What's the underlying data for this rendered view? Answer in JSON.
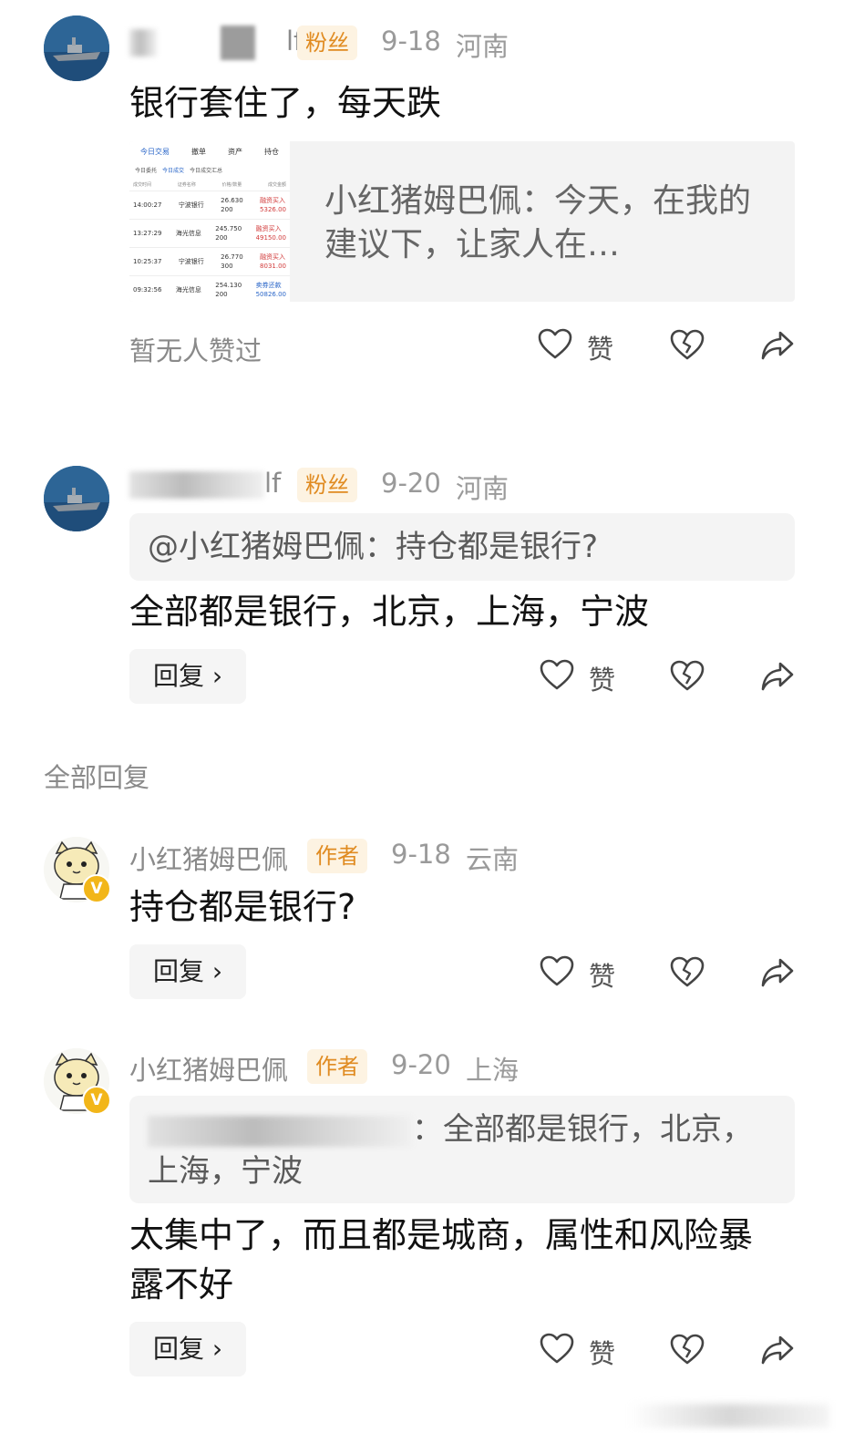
{
  "comments": [
    {
      "username_suffix": "lf",
      "badge": "粉丝",
      "date": "9-18",
      "location": "河南",
      "content": "银行套住了，每天跌",
      "card": {
        "text": "小红猪姆巴佩：今天，在我的建议下，让家人在…",
        "thumb": {
          "tabs": [
            "今日交易",
            "撤单",
            "资产",
            "持仓"
          ],
          "subtabs": [
            "今日委托",
            "今日成交",
            "今日成交汇总"
          ],
          "headers": [
            "成交时间",
            "证券名称",
            "价格/数量",
            "成交金额"
          ],
          "rows": [
            {
              "time": "14:00:27",
              "name": "宁波银行",
              "price": "26.630",
              "qty": "200",
              "type": "融资买入",
              "amount": "5326.00"
            },
            {
              "time": "13:27:29",
              "name": "海光信息",
              "price": "245.750",
              "qty": "200",
              "type": "融资买入",
              "amount": "49150.00"
            },
            {
              "time": "10:25:37",
              "name": "宁波银行",
              "price": "26.770",
              "qty": "300",
              "type": "融资买入",
              "amount": "8031.00"
            },
            {
              "time": "09:32:56",
              "name": "海光信息",
              "price": "254.130",
              "qty": "200",
              "type": "卖券还款",
              "amount": "50826.00"
            }
          ]
        }
      },
      "no_likes": "暂无人赞过",
      "like_label": "赞"
    },
    {
      "username_suffix": "lf",
      "badge": "粉丝",
      "date": "9-20",
      "location": "河南",
      "quote": "@小红猪姆巴佩：持仓都是银行?",
      "content": "全部都是银行，北京，上海，宁波",
      "reply_label": "回复",
      "like_label": "赞"
    }
  ],
  "section_title": "全部回复",
  "replies": [
    {
      "username": "小红猪姆巴佩",
      "badge": "作者",
      "date": "9-18",
      "location": "云南",
      "verified": "V",
      "content": "持仓都是银行?",
      "reply_label": "回复",
      "like_label": "赞"
    },
    {
      "username": "小红猪姆巴佩",
      "badge": "作者",
      "date": "9-20",
      "location": "上海",
      "verified": "V",
      "quote": "：全部都是银行，北京，上海，宁波",
      "content": "太集中了，而且都是城商，属性和风险暴露不好",
      "reply_label": "回复",
      "like_label": "赞"
    }
  ],
  "colors": {
    "fan_badge_bg": "#fdf3e2",
    "fan_badge_text": "#e08b21",
    "verified": "#f2b619"
  },
  "icons": [
    "heart-outline-icon",
    "broken-heart-icon",
    "share-arrow-icon",
    "chevron-right-icon"
  ]
}
